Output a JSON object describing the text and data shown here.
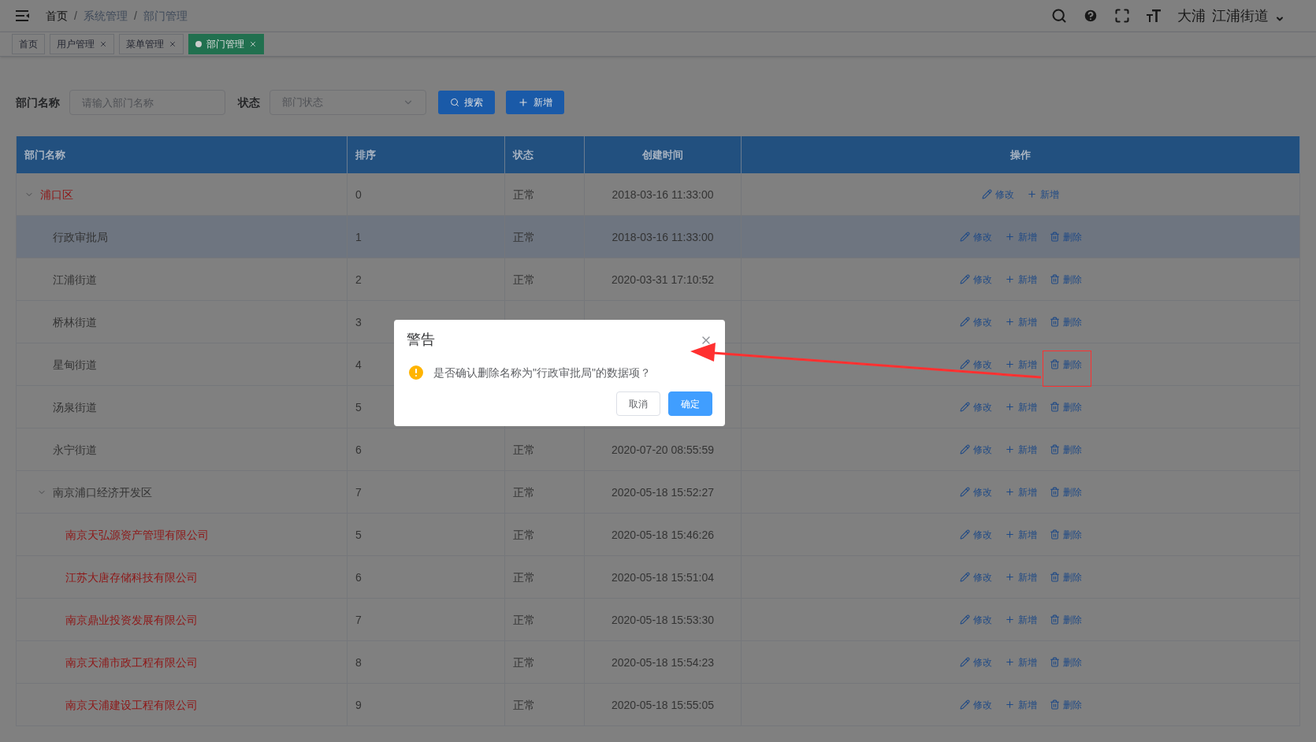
{
  "breadcrumb": [
    {
      "kind": "link",
      "label": "首页"
    },
    {
      "kind": "separator",
      "label": "/"
    },
    {
      "kind": "current",
      "label": "系统管理"
    },
    {
      "kind": "separator",
      "label": "/"
    },
    {
      "kind": "current",
      "label": "部门管理"
    }
  ],
  "user": {
    "name": "大浦",
    "unit": "江浦街道"
  },
  "tabs": [
    {
      "label": "首页",
      "selected": false,
      "closable": false
    },
    {
      "label": "用户管理",
      "selected": false,
      "closable": true
    },
    {
      "label": "菜单管理",
      "selected": false,
      "closable": true
    },
    {
      "label": "部门管理",
      "selected": true,
      "closable": true
    }
  ],
  "filters": {
    "name_label": "部门名称",
    "name_placeholder": "请输入部门名称",
    "status_label": "状态",
    "status_placeholder": "部门状态"
  },
  "buttons": [
    {
      "kind": "search",
      "label": "搜索"
    },
    {
      "kind": "add",
      "label": "新增"
    }
  ],
  "table": {
    "columns": [
      "部门名称",
      "排序",
      "状态",
      "创建时间",
      "操作"
    ],
    "rows": [
      {
        "name": "浦口区",
        "sort": "0",
        "status": "正常",
        "created": "2018-03-16 11:33:00",
        "color": "#8e1515",
        "expanded": true,
        "selected": false,
        "actions": [
          {
            "kind": "edit",
            "label": "修改"
          },
          {
            "kind": "add",
            "label": "新增"
          }
        ],
        "children": [
          {
            "name": "行政审批局",
            "sort": "1",
            "status": "正常",
            "created": "2018-03-16 11:33:00",
            "color": "#333333",
            "selected": true,
            "actions": [
              {
                "kind": "edit",
                "label": "修改"
              },
              {
                "kind": "add",
                "label": "新增"
              },
              {
                "kind": "delete",
                "label": "删除"
              }
            ]
          },
          {
            "name": "江浦街道",
            "sort": "2",
            "status": "正常",
            "created": "2020-03-31 17:10:52",
            "color": "#333333",
            "selected": false,
            "actions": [
              {
                "kind": "edit",
                "label": "修改"
              },
              {
                "kind": "add",
                "label": "新增"
              },
              {
                "kind": "delete",
                "label": "删除"
              }
            ]
          },
          {
            "name": "桥林街道",
            "sort": "3",
            "color": "#333333",
            "selected": false,
            "actions": [
              {
                "kind": "edit",
                "label": "修改"
              },
              {
                "kind": "add",
                "label": "新增"
              },
              {
                "kind": "delete",
                "label": "删除"
              }
            ]
          },
          {
            "name": "星甸街道",
            "sort": "4",
            "color": "#333333",
            "selected": false,
            "actions": [
              {
                "kind": "edit",
                "label": "修改"
              },
              {
                "kind": "add",
                "label": "新增"
              },
              {
                "kind": "delete",
                "label": "删除"
              }
            ]
          },
          {
            "name": "汤泉街道",
            "sort": "5",
            "color": "#333333",
            "selected": false,
            "actions": [
              {
                "kind": "edit",
                "label": "修改"
              },
              {
                "kind": "add",
                "label": "新增"
              },
              {
                "kind": "delete",
                "label": "删除"
              }
            ]
          },
          {
            "name": "永宁街道",
            "sort": "6",
            "status": "正常",
            "created": "2020-07-20 08:55:59",
            "color": "#333333",
            "selected": false,
            "actions": [
              {
                "kind": "edit",
                "label": "修改"
              },
              {
                "kind": "add",
                "label": "新增"
              },
              {
                "kind": "delete",
                "label": "删除"
              }
            ]
          },
          {
            "name": "南京浦口经济开发区",
            "sort": "7",
            "status": "正常",
            "created": "2020-05-18 15:52:27",
            "color": "#333333",
            "expanded": true,
            "selected": false,
            "actions": [
              {
                "kind": "edit",
                "label": "修改"
              },
              {
                "kind": "add",
                "label": "新增"
              },
              {
                "kind": "delete",
                "label": "删除"
              }
            ],
            "children": [
              {
                "name": "南京天弘源资产管理有限公司",
                "sort": "5",
                "status": "正常",
                "created": "2020-05-18 15:46:26",
                "color": "#8e1515",
                "selected": false,
                "actions": [
                  {
                    "kind": "edit",
                    "label": "修改"
                  },
                  {
                    "kind": "add",
                    "label": "新增"
                  },
                  {
                    "kind": "delete",
                    "label": "删除"
                  }
                ]
              },
              {
                "name": "江苏大唐存储科技有限公司",
                "sort": "6",
                "status": "正常",
                "created": "2020-05-18 15:51:04",
                "color": "#8e1515",
                "selected": false,
                "actions": [
                  {
                    "kind": "edit",
                    "label": "修改"
                  },
                  {
                    "kind": "add",
                    "label": "新增"
                  },
                  {
                    "kind": "delete",
                    "label": "删除"
                  }
                ]
              },
              {
                "name": "南京鼎业投资发展有限公司",
                "sort": "7",
                "status": "正常",
                "created": "2020-05-18 15:53:30",
                "color": "#8e1515",
                "selected": false,
                "actions": [
                  {
                    "kind": "edit",
                    "label": "修改"
                  },
                  {
                    "kind": "add",
                    "label": "新增"
                  },
                  {
                    "kind": "delete",
                    "label": "删除"
                  }
                ]
              },
              {
                "name": "南京天浦市政工程有限公司",
                "sort": "8",
                "status": "正常",
                "created": "2020-05-18 15:54:23",
                "color": "#8e1515",
                "selected": false,
                "actions": [
                  {
                    "kind": "edit",
                    "label": "修改"
                  },
                  {
                    "kind": "add",
                    "label": "新增"
                  },
                  {
                    "kind": "delete",
                    "label": "删除"
                  }
                ]
              },
              {
                "name": "南京天浦建设工程有限公司",
                "sort": "9",
                "status": "正常",
                "created": "2020-05-18 15:55:05",
                "color": "#8e1515",
                "selected": false,
                "actions": [
                  {
                    "kind": "edit",
                    "label": "修改"
                  },
                  {
                    "kind": "add",
                    "label": "新增"
                  },
                  {
                    "kind": "delete",
                    "label": "删除"
                  }
                ]
              }
            ]
          }
        ]
      }
    ]
  },
  "dialog": {
    "title": "警告",
    "message": "是否确认删除名称为\"行政审批局\"的数据项？",
    "buttons": [
      {
        "label": "取消",
        "primary": false
      },
      {
        "label": "确定",
        "primary": true
      }
    ]
  }
}
